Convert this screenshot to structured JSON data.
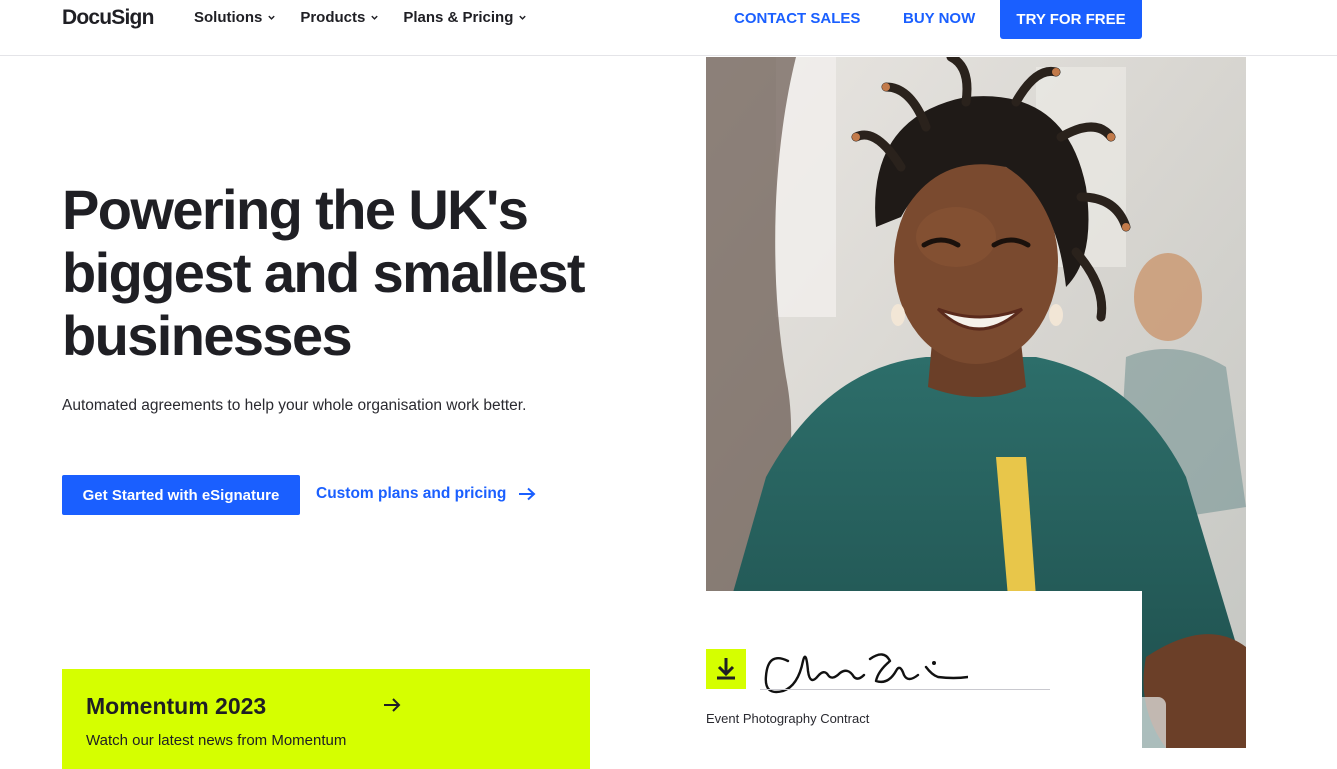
{
  "header": {
    "logo": "DocuSign",
    "nav": [
      {
        "label": "Solutions"
      },
      {
        "label": "Products"
      },
      {
        "label": "Plans & Pricing"
      }
    ],
    "contact_sales": "CONTACT SALES",
    "buy_now": "BUY NOW",
    "try_free": "TRY FOR FREE"
  },
  "hero": {
    "headline": "Powering the UK's biggest and smallest businesses",
    "subtitle": "Automated agreements to help your whole organisation work better.",
    "cta_primary": "Get Started with eSignature",
    "cta_secondary": "Custom plans and pricing"
  },
  "promo": {
    "title": "Momentum 2023",
    "subtitle": "Watch our latest news from Momentum"
  },
  "signature_card": {
    "caption": "Event Photography Contract"
  },
  "colors": {
    "brand_blue": "#1a5fff",
    "accent_lime": "#d5ff00",
    "text_dark": "#1f1f24"
  }
}
